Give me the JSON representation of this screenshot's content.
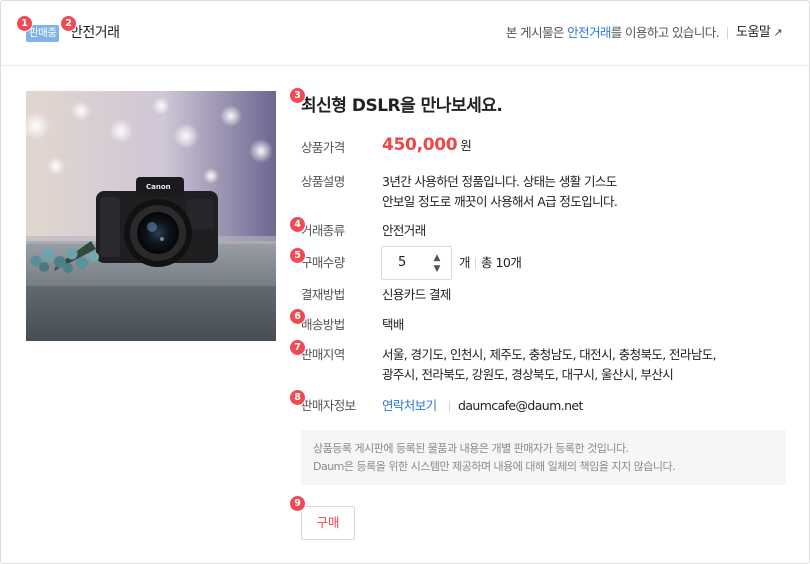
{
  "header": {
    "status_badge": "판매중",
    "title": "안전거래",
    "notice_prefix": "본 게시물은 ",
    "notice_link": "안전거래",
    "notice_suffix": "를 이용하고 있습니다.",
    "help_label": "도움말",
    "help_icon": "↗"
  },
  "product": {
    "image_icon": "camera-photo",
    "title": "최신형 DSLR을 만나보세요.",
    "price_label": "상품가격",
    "price_value": "450,000",
    "price_unit": "원",
    "description_label": "상품설명",
    "description_line1": "3년간 사용하던 정품입니다. 상태는 생활 기스도",
    "description_line2": "안보일 정도로 깨끗이 사용해서 A급 정도입니다.",
    "trade_type_label": "거래종류",
    "trade_type_value": "안전거래",
    "quantity_label": "구매수량",
    "quantity_value": "5",
    "quantity_unit": "개",
    "quantity_total": "총 10개",
    "payment_label": "결재방법",
    "payment_value": "신용카드 결제",
    "shipping_label": "배송방법",
    "shipping_value": "택배",
    "region_label": "판매지역",
    "region_line1": "서울, 경기도, 인천시, 제주도, 충청남도, 대전시, 충청북도, 전라남도,",
    "region_line2": "광주시, 전라북도, 강원도, 경상북도, 대구시, 울산시, 부산시",
    "seller_label": "판매자정보",
    "seller_contact_link": "연락처보기",
    "seller_email": "daumcafe@daum.net"
  },
  "disclaimer": {
    "line1": "상품등록 게시판에 등록된 물품과 내용은 개별 판매자가 등록한 것입니다.",
    "line2": "Daum은 등록을 위한 시스템만 제공하며 내용에 대해 일체의 책임을 지지 않습니다."
  },
  "actions": {
    "buy_label": "구매"
  },
  "markers": [
    "1",
    "2",
    "3",
    "4",
    "5",
    "6",
    "7",
    "8",
    "9"
  ],
  "colors": {
    "accent_red": "#f0454b",
    "link_blue": "#2c77d6",
    "badge_blue": "#7fb2e9",
    "marker_red": "#ef4b55"
  }
}
